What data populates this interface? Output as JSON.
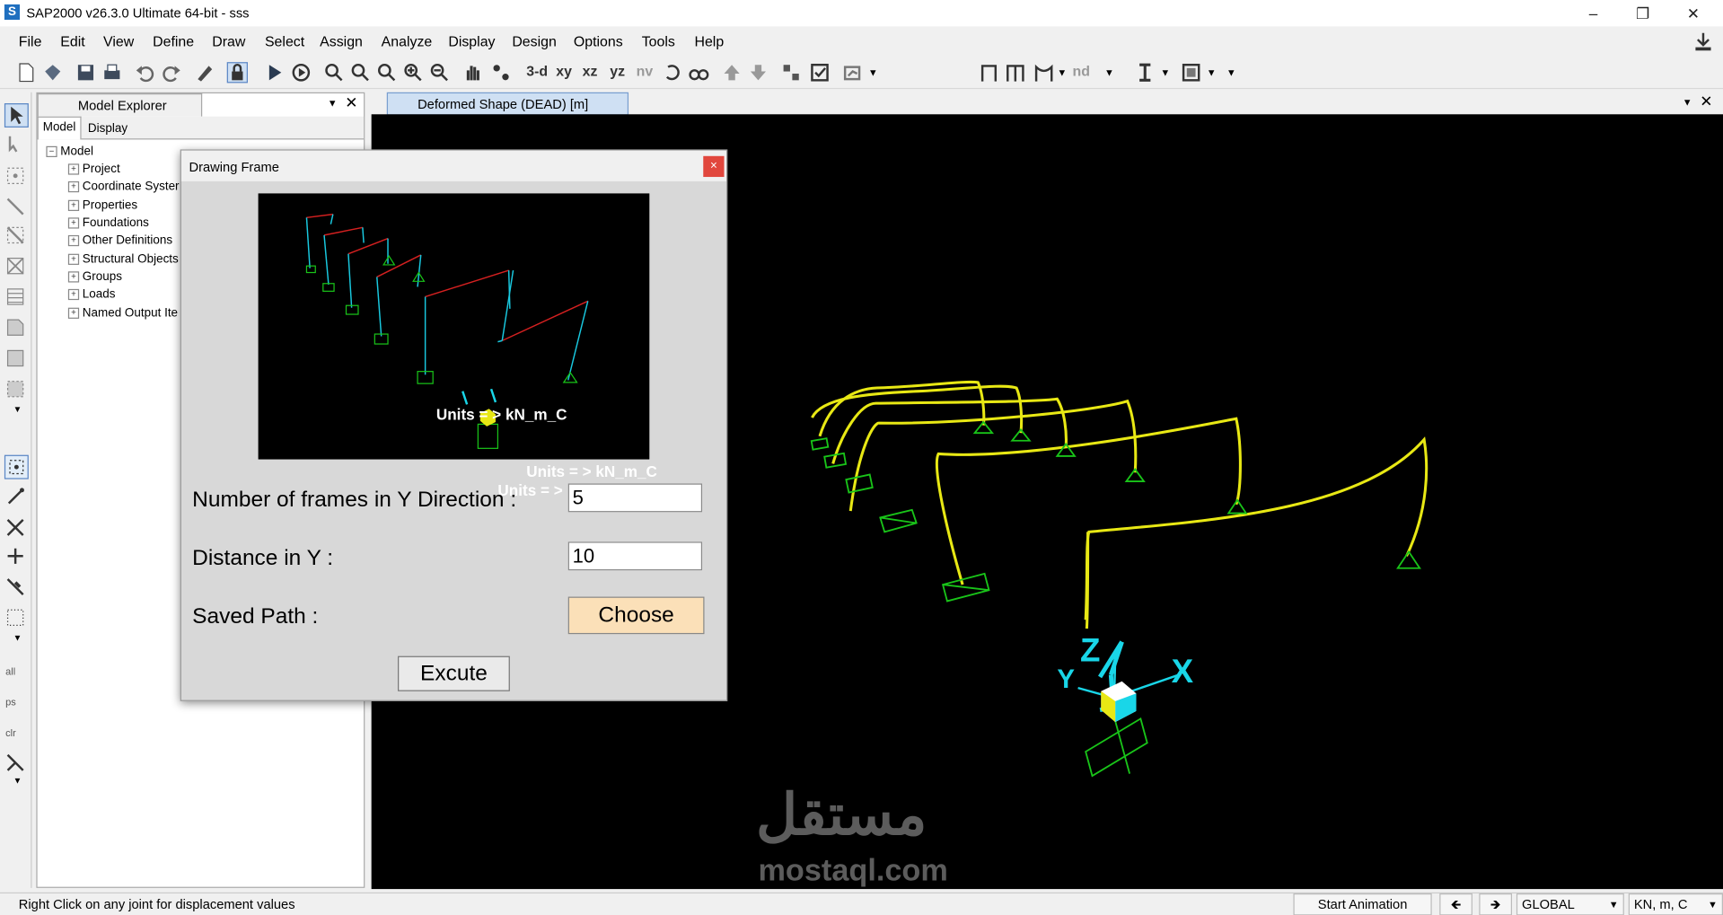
{
  "window": {
    "title": "SAP2000 v26.3.0 Ultimate 64-bit - sss",
    "app_icon_letter": "S"
  },
  "menu": [
    "File",
    "Edit",
    "View",
    "Define",
    "Draw",
    "Select",
    "Assign",
    "Analyze",
    "Display",
    "Design",
    "Options",
    "Tools",
    "Help"
  ],
  "toolbar": {
    "view_3d": "3-d",
    "view_xy": "xy",
    "view_xz": "xz",
    "view_yz": "yz",
    "view_nv": "nv",
    "nd": "nd"
  },
  "explorer": {
    "title": "Model Explorer",
    "tabs": [
      "Model",
      "Display"
    ],
    "root": "Model",
    "items": [
      "Project",
      "Coordinate Syster",
      "Properties",
      "Foundations",
      "Other Definitions",
      "Structural Objects",
      "Groups",
      "Loads",
      "Named Output Ite"
    ]
  },
  "viewport": {
    "tab_label": "Deformed Shape (DEAD)  [m]"
  },
  "dialog": {
    "title": "Drawing Frame",
    "close": "×",
    "preview_units": "Units = > kN_m_C",
    "ghost_units_1": "Units = > kN_m_C",
    "ghost_units_2": "Units = >",
    "frames_label": "Number of frames in Y Direction :",
    "frames_value": "5",
    "distance_label": "Distance in Y :",
    "distance_value": "10",
    "path_label": "Saved Path :",
    "choose_label": "Choose",
    "excute_label": "Excute"
  },
  "axes": {
    "z": "Z",
    "x": "X",
    "y": "Y"
  },
  "watermark": {
    "arabic": "مستقل",
    "latin": "mostaql.com"
  },
  "status": {
    "message": "Right Click on any joint for displacement values",
    "animation": "Start Animation",
    "coord_system": "GLOBAL",
    "units": "KN, m, C"
  },
  "colors": {
    "frame": "#e8e814",
    "support": "#19c419",
    "axis": "#19d6e8",
    "preview_beam": "#d42020",
    "preview_column": "#19c9e0",
    "choose_bg": "#fbe0b8",
    "close_red": "#e1473d"
  }
}
